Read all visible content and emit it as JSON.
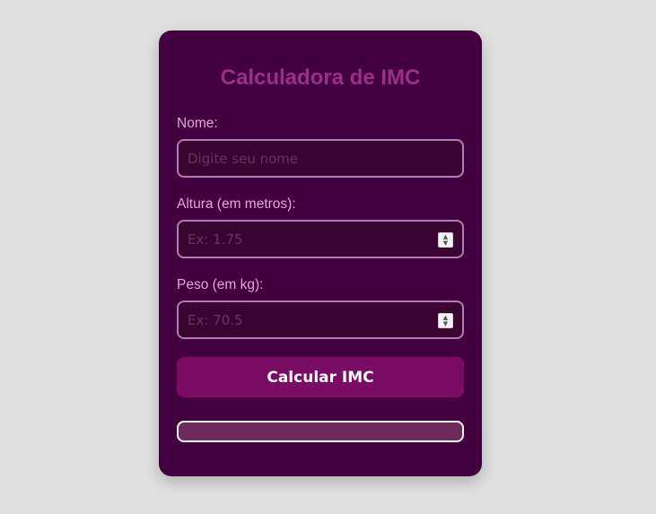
{
  "app": {
    "title": "Calculadora de IMC"
  },
  "form": {
    "nome": {
      "label": "Nome:",
      "placeholder": "Digite seu nome",
      "value": ""
    },
    "altura": {
      "label": "Altura (em metros):",
      "placeholder": "Ex: 1.75",
      "value": ""
    },
    "peso": {
      "label": "Peso (em kg):",
      "placeholder": "Ex: 70.5",
      "value": ""
    },
    "submit_label": "Calcular IMC"
  },
  "result": {
    "text": ""
  },
  "colors": {
    "page_background": "#e0e0e0",
    "card_background": "#420040",
    "title": "#9b2f8a",
    "label": "#e4a6da",
    "input_border": "#b57ab0",
    "button": "#7a0c66",
    "result_background": "#6e2a5e"
  }
}
